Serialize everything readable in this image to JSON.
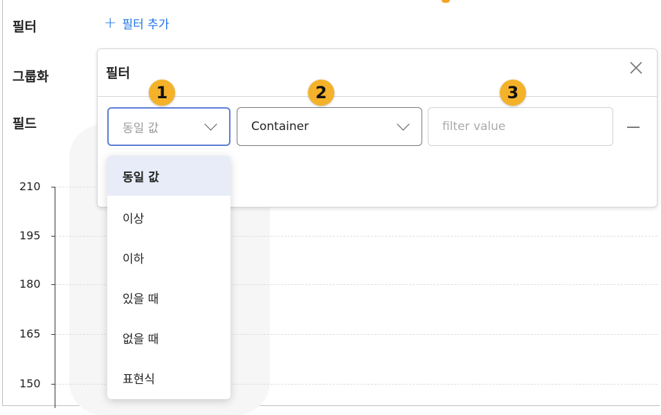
{
  "header": {
    "filter_label": "필터",
    "add_filter_plus": "+",
    "add_filter_label": "필터 추가",
    "group_label": "그룹화",
    "field_label": "필드"
  },
  "chart": {
    "y_ticks": [
      "210",
      "195",
      "180",
      "165",
      "150"
    ]
  },
  "filter_panel": {
    "title": "필터",
    "close_icon": "close-icon",
    "operator_select": {
      "value": "동일 값"
    },
    "field_select": {
      "value": "Container"
    },
    "value_input": {
      "placeholder": "filter value",
      "value": ""
    },
    "remove_icon": "minus-icon"
  },
  "badges": [
    "1",
    "2",
    "3"
  ],
  "operator_menu": {
    "selected": "동일 값",
    "options": [
      "동일 값",
      "이상",
      "이하",
      "있을 때",
      "없을 때",
      "표현식"
    ]
  },
  "colors": {
    "accent_link": "#1a73e8",
    "badge": "#f4b22a",
    "selected_option_bg": "#e8ecf8",
    "focused_border": "#5a7bd6"
  }
}
